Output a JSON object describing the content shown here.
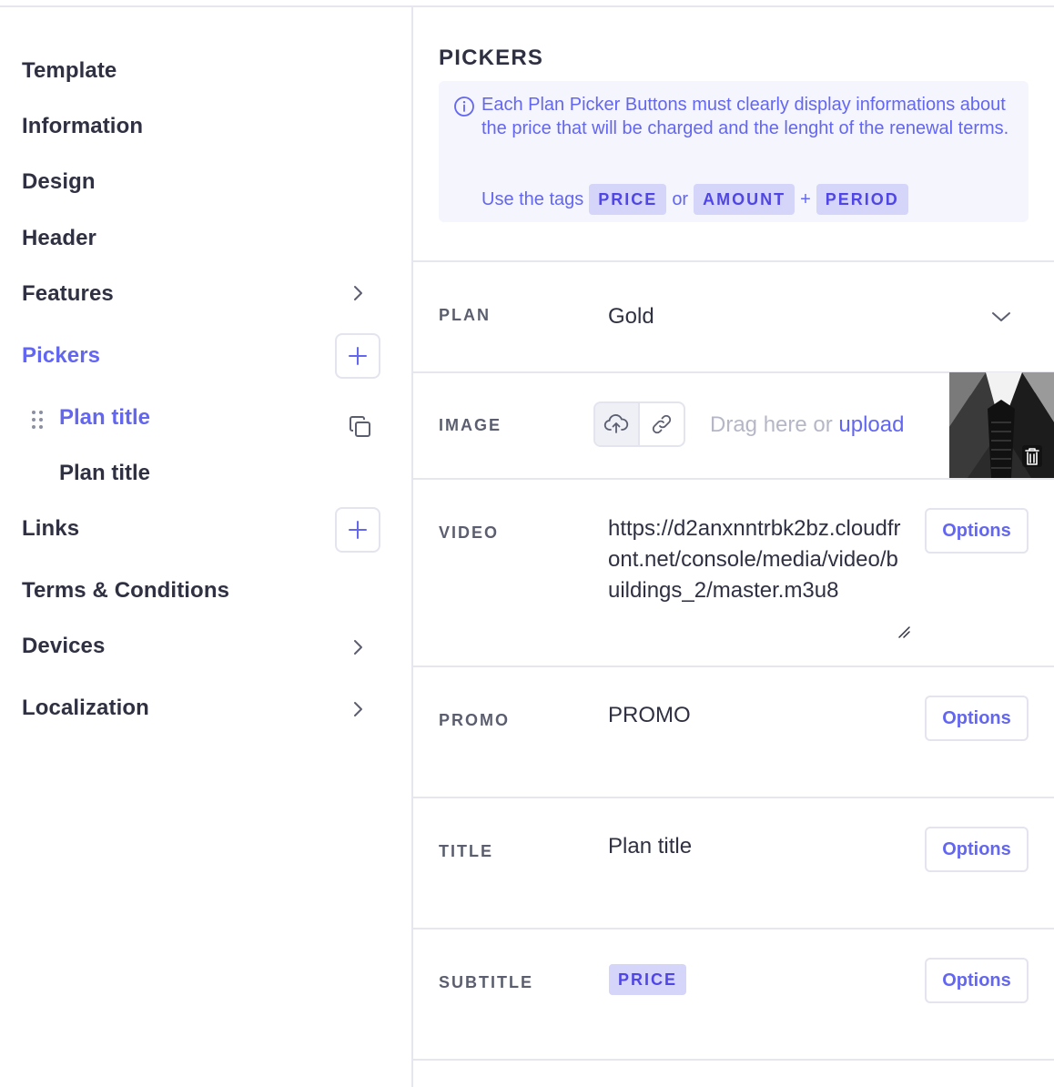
{
  "sidebar": {
    "items": [
      {
        "label": "Template"
      },
      {
        "label": "Information"
      },
      {
        "label": "Design"
      },
      {
        "label": "Header"
      },
      {
        "label": "Features"
      },
      {
        "label": "Pickers"
      },
      {
        "label": "Links"
      },
      {
        "label": "Terms & Conditions"
      },
      {
        "label": "Devices"
      },
      {
        "label": "Localization"
      }
    ],
    "pickers_children": [
      {
        "label": "Plan title"
      },
      {
        "label": "Plan title"
      }
    ],
    "active": "Pickers"
  },
  "main": {
    "section_title": "PICKERS",
    "info": {
      "message": "Each Plan Picker Buttons must clearly display informations about the price that will be charged and the lenght of the renewal terms.",
      "tags_prefix": "Use the tags",
      "tag_price": "PRICE",
      "or": "or",
      "tag_amount": "AMOUNT",
      "plus": "+",
      "tag_period": "PERIOD"
    },
    "rows": {
      "plan": {
        "label": "PLAN",
        "value": "Gold"
      },
      "image": {
        "label": "IMAGE",
        "drag_text": "Drag here or",
        "upload_link": "upload"
      },
      "video": {
        "label": "VIDEO",
        "value": "https://d2anxnntrbk2bz.cloudfront.net/console/media/video/buildings_2/master.m3u8",
        "options": "Options"
      },
      "promo": {
        "label": "PROMO",
        "value": "PROMO",
        "options": "Options"
      },
      "title": {
        "label": "TITLE",
        "value": "Plan title",
        "options": "Options"
      },
      "subtitle": {
        "label": "SUBTITLE",
        "tag": "PRICE",
        "options": "Options"
      }
    }
  },
  "colors": {
    "accent": "#6366f1",
    "text": "#2f3142",
    "muted": "#5b5e6f",
    "border": "#e3e4ee",
    "info_bg": "#f5f5fd",
    "tag_bg": "#d4d5f8"
  }
}
